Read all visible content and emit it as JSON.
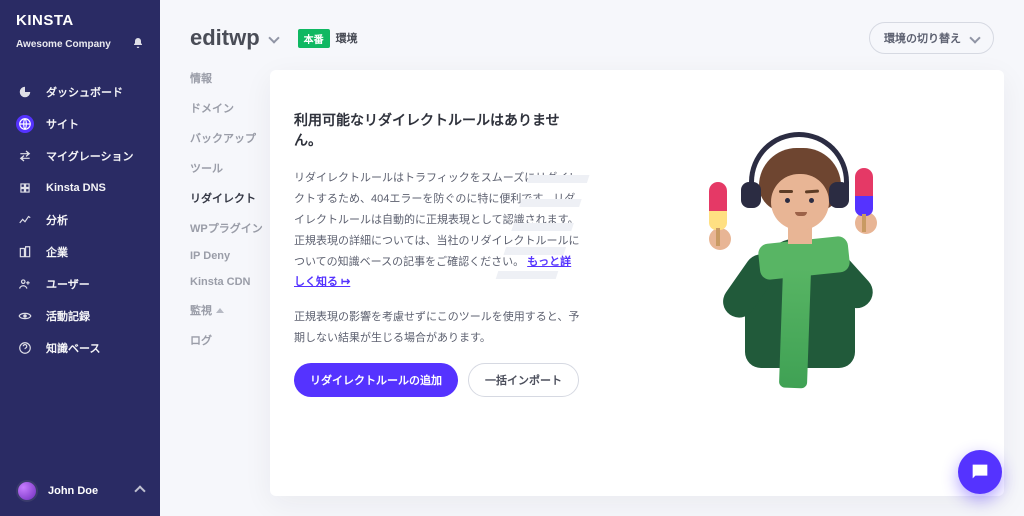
{
  "brand": {
    "logo_text": "KINSTA",
    "company": "Awesome Company"
  },
  "primary_nav": {
    "items": [
      {
        "label": "ダッシュボード",
        "icon": "dashboard-icon"
      },
      {
        "label": "サイト",
        "icon": "site-icon"
      },
      {
        "label": "マイグレーション",
        "icon": "migration-icon"
      },
      {
        "label": "Kinsta DNS",
        "icon": "dns-icon"
      },
      {
        "label": "分析",
        "icon": "analytics-icon"
      },
      {
        "label": "企業",
        "icon": "company-icon"
      },
      {
        "label": "ユーザー",
        "icon": "users-icon"
      },
      {
        "label": "活動記録",
        "icon": "activity-icon"
      },
      {
        "label": "知識ベース",
        "icon": "knowledge-icon"
      }
    ],
    "active_index": 1
  },
  "user": {
    "name": "John Doe"
  },
  "topbar": {
    "site_name": "editwp",
    "env_tag": "本番",
    "env_label": "環境",
    "env_switch_label": "環境の切り替え"
  },
  "secondary_nav": {
    "items": [
      {
        "label": "情報"
      },
      {
        "label": "ドメイン"
      },
      {
        "label": "バックアップ"
      },
      {
        "label": "ツール"
      },
      {
        "label": "リダイレクト"
      },
      {
        "label": "WPプラグイン"
      },
      {
        "label": "IP Deny"
      },
      {
        "label": "Kinsta CDN"
      },
      {
        "label": "監視",
        "badge": true
      },
      {
        "label": "ログ"
      }
    ],
    "active_index": 4
  },
  "card": {
    "heading": "利用可能なリダイレクトルールはありません。",
    "paragraph1_a": "リダイレクトルールはトラフィックをスムーズにリダイレクトするため、404エラーを防ぐのに特に便利です。リダイレクトルールは自動的に正規表現として認識されます。正規表現の詳細については、当社のリダイレクトルールについての知識ベースの記事をご確認ください。",
    "learn_more": "もっと詳しく知る",
    "paragraph2": "正規表現の影響を考慮せずにこのツールを使用すると、予期しない結果が生じる場合があります。",
    "primary_btn": "リダイレクトルールの追加",
    "outline_btn": "一括インポート"
  }
}
